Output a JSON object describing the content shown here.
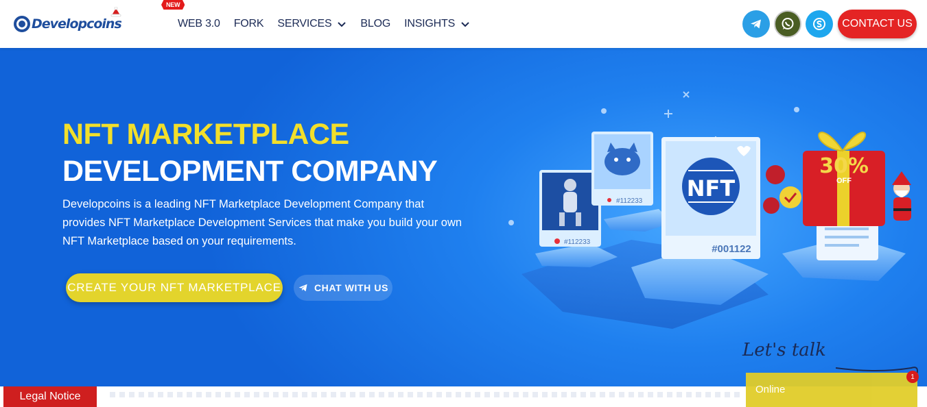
{
  "brand": {
    "name": "Developcoins"
  },
  "nav": {
    "new_badge": "NEW",
    "items": [
      {
        "label": "WEB 3.0"
      },
      {
        "label": "FORK"
      },
      {
        "label": "SERVICES"
      },
      {
        "label": "BLOG"
      },
      {
        "label": "INSIGHTS"
      }
    ]
  },
  "social": {
    "icons": [
      "telegram-icon",
      "whatsapp-icon",
      "skype-icon"
    ],
    "colors": {
      "telegram": "#2b9fe6",
      "whatsapp": "#4a5d23",
      "skype": "#1ea7ee"
    }
  },
  "header": {
    "contact_label": "CONTACT US"
  },
  "hero": {
    "title_line1": "NFT MARKETPLACE",
    "title_line2": "DEVELOPMENT COMPANY",
    "description": "Developcoins is a leading NFT Marketplace Development Company that provides NFT Marketplace Development Services that make you build your own NFT Marketplace based on your requirements.",
    "cta_primary": "CREATE YOUR NFT MARKETPLACE",
    "cta_chat": "CHAT WITH US"
  },
  "illustration": {
    "nft_label": "NFT",
    "card_main_id": "#001122",
    "card_robot_id": "#112233",
    "card_cat_id": "#112233",
    "offer": "30%",
    "offer_sub": "OFF"
  },
  "chat_widget": {
    "lets_talk": "Let's talk",
    "status": "Online",
    "badge_count": "1"
  },
  "footer": {
    "legal_notice": "Legal Notice"
  },
  "colors": {
    "accent_yellow": "#f2df2b",
    "button_yellow": "#e3d42c",
    "contact_red": "#e42424",
    "hero_blue": "#1f80ef",
    "nav_text": "#1b2a55"
  }
}
